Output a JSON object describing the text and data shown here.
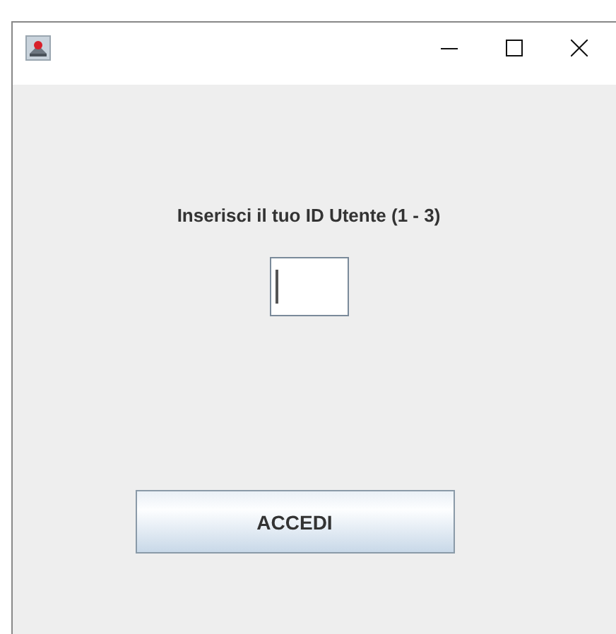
{
  "window": {
    "title_bar_buttons": [
      {
        "kind": "minimize"
      },
      {
        "kind": "maximize"
      },
      {
        "kind": "close"
      }
    ]
  },
  "prompt": "Inserisci il tuo ID Utente (1 - 3)",
  "id_field": {
    "focused": true
  },
  "button": "ACCEDI"
}
